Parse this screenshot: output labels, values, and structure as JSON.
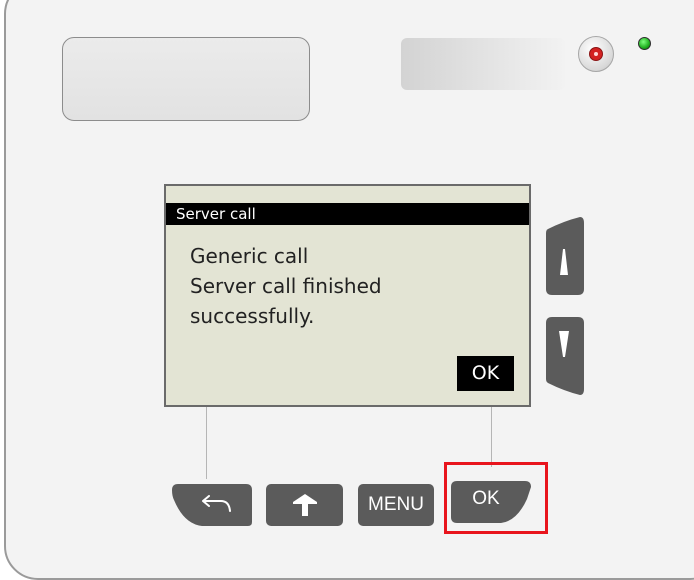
{
  "screen": {
    "title": "Server call",
    "lines": [
      "Generic call",
      "Server call finished",
      "successfully."
    ],
    "ok_label": "OK"
  },
  "softkeys": {
    "menu_label": "MENU",
    "ok_label": "OK"
  },
  "icons": {
    "power": "power-icon",
    "led": "status-led",
    "up": "arrow-up-icon",
    "down": "arrow-down-icon",
    "back": "back-arrow-icon",
    "home": "home-icon"
  },
  "colors": {
    "screen_bg": "#e3e4d4",
    "key_grey": "#5b5b5b",
    "led_green": "#1fae1f",
    "power_red": "#d32222",
    "highlight_red": "#e8141c"
  }
}
